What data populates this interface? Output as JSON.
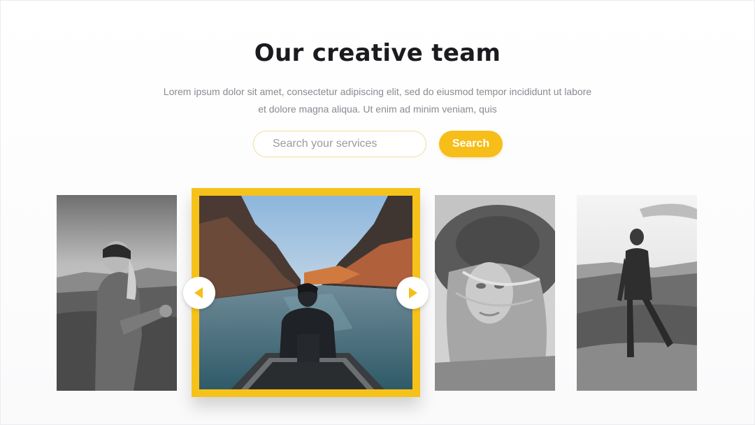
{
  "section": {
    "title": "Our creative team",
    "subtitle_line1": "Lorem ipsum dolor sit amet, consectetur adipiscing elit, sed do eiusmod tempor incididunt ut labore",
    "subtitle_line2": "et dolore magna aliqua. Ut enim ad minim veniam, quis"
  },
  "search": {
    "placeholder": "Search your services",
    "button_label": "Search"
  },
  "carousel": {
    "active_index": 1,
    "photos": [
      {
        "subject": "woman with headband reaching hand back in field",
        "style": "grayscale"
      },
      {
        "subject": "man on boat bow facing river with autumn trees",
        "style": "color"
      },
      {
        "subject": "woman in wide-brim hat with windblown hair",
        "style": "grayscale"
      },
      {
        "subject": "man standing on hilltop facing away",
        "style": "grayscale"
      }
    ],
    "prev_icon": "triangle-left-icon",
    "next_icon": "triangle-right-icon"
  },
  "colors": {
    "accent": "#f7be19",
    "title": "#1b1b1f",
    "body_text": "#8a8a92"
  }
}
